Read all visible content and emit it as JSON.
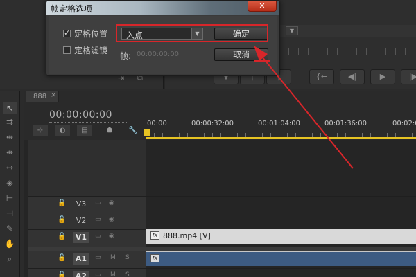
{
  "dialog": {
    "title": "帧定格选项",
    "close_label": "✕",
    "hold_position_label": "定格位置",
    "hold_position_checked": true,
    "hold_filters_label": "定格滤镜",
    "hold_filters_checked": false,
    "position_selected": "入点",
    "frame_label": "帧:",
    "frame_value": "00:00:00:00",
    "ok_label": "确定",
    "cancel_label": "取消"
  },
  "sequence": {
    "tab_label": "888",
    "tab_close": "×",
    "timecode": "00:00:00:00",
    "ruler_labels": [
      "00:00",
      "00:00:32:00",
      "00:01:04:00",
      "00:01:36:00",
      "00:02:0"
    ]
  },
  "tracks": {
    "video": [
      {
        "name": "V3",
        "active": false
      },
      {
        "name": "V2",
        "active": false
      },
      {
        "name": "V1",
        "active": true
      }
    ],
    "audio": [
      {
        "name": "A1",
        "active": true,
        "m": "M",
        "s": "S"
      },
      {
        "name": "A2",
        "active": false,
        "m": "M",
        "s": "S"
      }
    ]
  },
  "clips": {
    "video_label": "888.mp4 [V]",
    "fx_label": "fx"
  },
  "colors": {
    "annotation": "#d7262a",
    "playhead": "#d23c36",
    "audio_clip": "#3d5b82",
    "video_clip": "#d9d9d9",
    "ruler_marker": "#e6c323"
  }
}
